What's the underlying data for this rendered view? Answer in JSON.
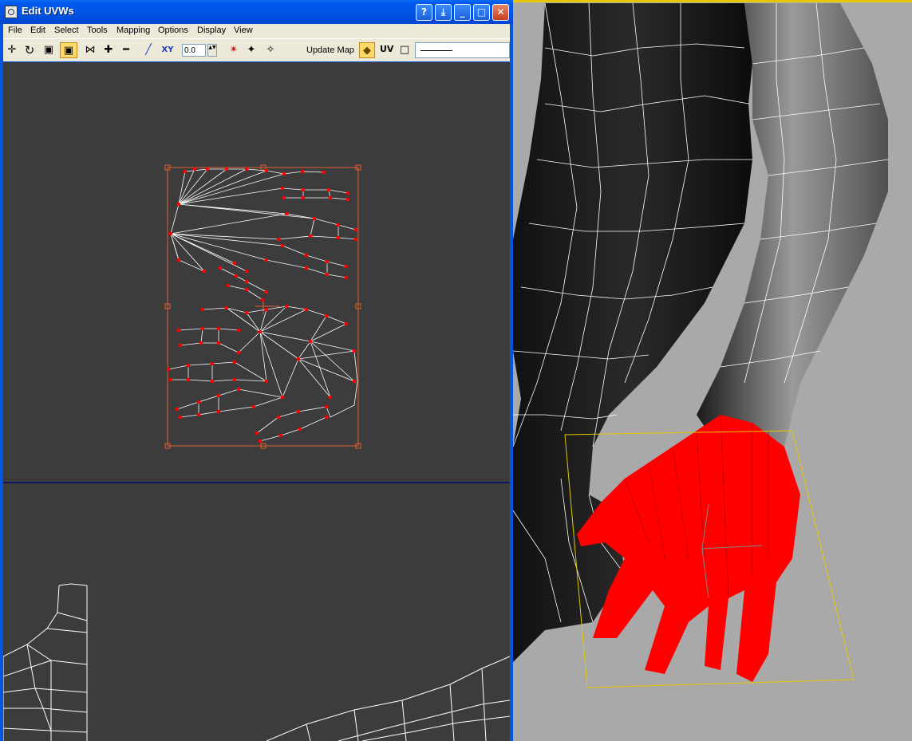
{
  "window": {
    "title": "Edit UVWs",
    "controls": {
      "help": "?",
      "restore_down": "⤓",
      "minimize": "_",
      "maximize": "□",
      "close": "✕"
    }
  },
  "menu": {
    "items": [
      {
        "label": "File"
      },
      {
        "label": "Edit"
      },
      {
        "label": "Select"
      },
      {
        "label": "Tools"
      },
      {
        "label": "Mapping"
      },
      {
        "label": "Options"
      },
      {
        "label": "Display"
      },
      {
        "label": "View"
      }
    ]
  },
  "toolbar": {
    "move_icon": "✛",
    "rotate_icon": "↻",
    "scale_icon": "▣",
    "freeform_icon": "▣",
    "mirror_icon": "⋈",
    "expand_icon": "✚",
    "contract_icon": "━",
    "line_icon": "╱",
    "xy_label": "XY",
    "value": "0.0",
    "spinner_glyph": "▲▼",
    "pick_icon": "✴",
    "snap_icon": "✦",
    "paste_icon": "✧",
    "update_map": "Update Map",
    "cube_icon": "◆",
    "uv_label": "UV",
    "square_icon": "□"
  },
  "colors": {
    "canvas_bg": "#3c3c3c",
    "vertex": "#ff0000",
    "selection_box": "#e06030",
    "viewport_bg": "#a9a9a9",
    "hand": "#ff0000",
    "gizmo": "#e6c800"
  }
}
